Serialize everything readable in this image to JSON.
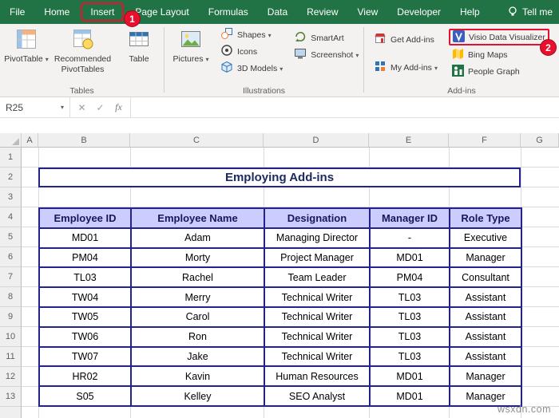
{
  "colors": {
    "excel_green": "#217346",
    "annotation_red": "#e8112d",
    "table_border": "#23238b",
    "table_header_fill": "#ccccff",
    "title_text": "#1f2a63"
  },
  "tabbar": {
    "tabs": [
      "File",
      "Home",
      "Insert",
      "Page Layout",
      "Formulas",
      "Data",
      "Review",
      "View",
      "Developer",
      "Help"
    ],
    "selected_tab": "Insert",
    "tell_me": "Tell me"
  },
  "ribbon": {
    "groups": [
      {
        "label": "Tables",
        "buttons": [
          {
            "label": "PivotTable"
          },
          {
            "label": "Recommended PivotTables"
          },
          {
            "label": "Table"
          }
        ]
      },
      {
        "label": "Illustrations",
        "buttons": [
          {
            "label": "Pictures"
          },
          {
            "label": "Shapes"
          },
          {
            "label": "Icons"
          },
          {
            "label": "3D Models"
          },
          {
            "label": "SmartArt"
          },
          {
            "label": "Screenshot"
          }
        ]
      },
      {
        "label": "Add-ins",
        "buttons": [
          {
            "label": "Get Add-ins"
          },
          {
            "label": "My Add-ins"
          },
          {
            "label": "Visio Data Visualizer"
          },
          {
            "label": "Bing Maps"
          },
          {
            "label": "People Graph"
          }
        ]
      }
    ]
  },
  "formula_bar": {
    "name_box": "R25",
    "cancel_icon": "✕",
    "enter_icon": "✓",
    "fx_icon": "fx",
    "value": ""
  },
  "grid": {
    "col_headers": [
      "A",
      "B",
      "C",
      "D",
      "E",
      "F",
      "G"
    ],
    "row_headers": [
      "1",
      "2",
      "3",
      "4",
      "5",
      "6",
      "7",
      "8",
      "9",
      "10",
      "11",
      "12",
      "13"
    ]
  },
  "sheet": {
    "title": "Employing Add-ins",
    "table": {
      "headers": [
        "Employee ID",
        "Employee Name",
        "Designation",
        "Manager ID",
        "Role Type"
      ],
      "rows": [
        [
          "MD01",
          "Adam",
          "Managing Director",
          "-",
          "Executive"
        ],
        [
          "PM04",
          "Morty",
          "Project Manager",
          "MD01",
          "Manager"
        ],
        [
          "TL03",
          "Rachel",
          "Team Leader",
          "PM04",
          "Consultant"
        ],
        [
          "TW04",
          "Merry",
          "Technical Writer",
          "TL03",
          "Assistant"
        ],
        [
          "TW05",
          "Carol",
          "Technical Writer",
          "TL03",
          "Assistant"
        ],
        [
          "TW06",
          "Ron",
          "Technical Writer",
          "TL03",
          "Assistant"
        ],
        [
          "TW07",
          "Jake",
          "Technical Writer",
          "TL03",
          "Assistant"
        ],
        [
          "HR02",
          "Kavin",
          "Human Resources",
          "MD01",
          "Manager"
        ],
        [
          "S05",
          "Kelley",
          "SEO Analyst",
          "MD01",
          "Manager"
        ]
      ]
    }
  },
  "annotations": {
    "step1": "1",
    "step2": "2"
  },
  "watermark": {
    "text": "wsxdn.com"
  }
}
